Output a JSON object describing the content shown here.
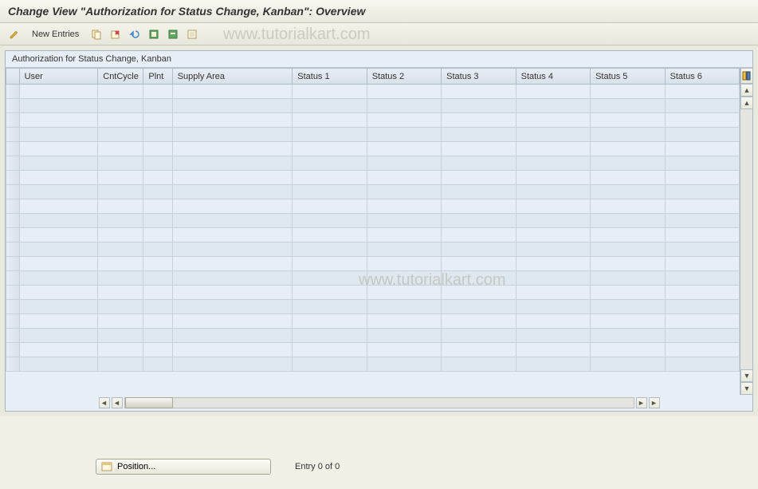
{
  "title": "Change View \"Authorization for Status Change, Kanban\": Overview",
  "toolbar": {
    "new_entries_label": "New Entries"
  },
  "panel": {
    "title": "Authorization for Status Change, Kanban"
  },
  "columns": {
    "user": "User",
    "cntCycle": "CntCycle",
    "plnt": "Plnt",
    "supplyArea": "Supply Area",
    "status1": "Status 1",
    "status2": "Status 2",
    "status3": "Status 3",
    "status4": "Status 4",
    "status5": "Status 5",
    "status6": "Status 6"
  },
  "footer": {
    "position_label": "Position...",
    "entry_text": "Entry 0 of 0"
  },
  "watermark": "www.tutorialkart.com"
}
